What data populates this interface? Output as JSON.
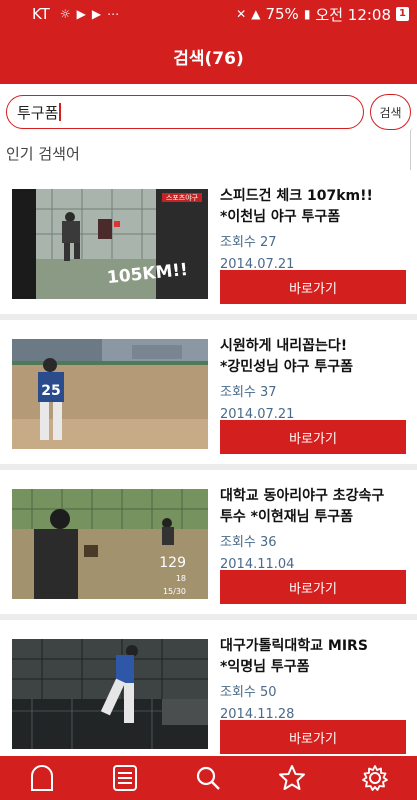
{
  "status_bar": {
    "carrier": "KT",
    "icons": [
      "alarm-icon",
      "play-icon",
      "play-icon",
      "more-icon",
      "mute-icon",
      "alarm-clock-icon",
      "hd-icon",
      "lte-icon",
      "signal-icon"
    ],
    "battery": "75%",
    "time": "오전 12:08",
    "notification_count": "1"
  },
  "header": {
    "title": "검색(76)"
  },
  "search": {
    "value": "투구폼",
    "button_label": "검색"
  },
  "popular_label": "인기 검색어",
  "results": [
    {
      "title_line1": "스피드건 체크 107km!!",
      "title_line2": "*이천님 야구 투구폼",
      "views": "조회수 27",
      "date": "2014.07.21",
      "button_label": "바로가기",
      "thumb_overlay": "105KM!!",
      "thumb_logo": "스포츠야구"
    },
    {
      "title_line1": "시원하게 내리꼽는다!",
      "title_line2": "*강민성님 야구 투구폼",
      "views": "조회수 37",
      "date": "2014.07.21",
      "button_label": "바로가기",
      "thumb_jersey": "25"
    },
    {
      "title_line1": "대학교 동아리야구 초강속구",
      "title_line2": "투수 *이현재님 투구폼",
      "views": "조회수 36",
      "date": "2014.11.04",
      "button_label": "바로가기",
      "thumb_speed": "129",
      "thumb_count": "18",
      "thumb_frames": "15/30"
    },
    {
      "title_line1": "대구가톨릭대학교 MIRS",
      "title_line2": "*익명님 투구폼",
      "views": "조회수 50",
      "date": "2014.11.28",
      "button_label": "바로가기"
    }
  ],
  "tabbar": {
    "tabs": [
      "home-icon",
      "list-icon",
      "search-icon",
      "star-icon",
      "gear-icon"
    ]
  },
  "colors": {
    "brand_red": "#d41f1f",
    "meta_blue": "#4a6a8a"
  }
}
